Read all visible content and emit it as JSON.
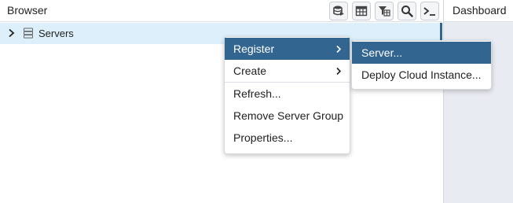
{
  "browser": {
    "title": "Browser",
    "toolbar": [
      {
        "icon": "query-tool-icon"
      },
      {
        "icon": "view-data-icon"
      },
      {
        "icon": "filter-rows-icon"
      },
      {
        "icon": "search-icon"
      },
      {
        "icon": "psql-tool-icon"
      }
    ],
    "tree": {
      "items": [
        {
          "label": "Servers",
          "expanded": false
        }
      ]
    }
  },
  "dashboard": {
    "tab_label": "Dashboard"
  },
  "context_menu": {
    "items": [
      {
        "label": "Register",
        "has_submenu": true,
        "active": true
      },
      {
        "label": "Create",
        "has_submenu": true,
        "active": false
      },
      {
        "label": "Refresh...",
        "has_submenu": false,
        "active": false
      },
      {
        "label": "Remove Server Group",
        "has_submenu": false,
        "active": false
      },
      {
        "label": "Properties...",
        "has_submenu": false,
        "active": false
      }
    ]
  },
  "submenu": {
    "items": [
      {
        "label": "Server...",
        "active": true
      },
      {
        "label": "Deploy Cloud Instance...",
        "active": false
      }
    ]
  },
  "colors": {
    "accent": "#326690",
    "selected_row": "#dceffa",
    "right_panel_bg": "#e8ebf1"
  }
}
